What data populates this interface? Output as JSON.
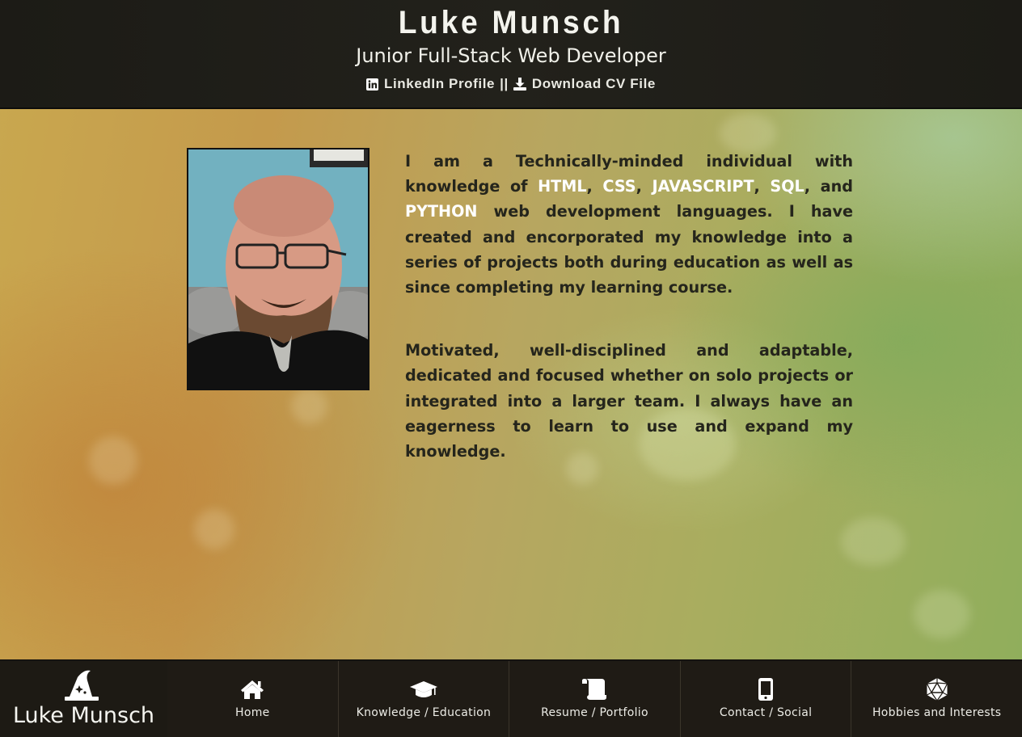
{
  "header": {
    "name": "Luke Munsch",
    "role": "Junior Full-Stack Web Developer",
    "linkedin_label": "LinkedIn Profile",
    "separator": "||",
    "cv_label": "Download CV File"
  },
  "about": {
    "p1_start": "I am a Technically-minded individual with knowledge of ",
    "skills": [
      "HTML",
      "CSS",
      "JAVASCRIPT",
      "SQL",
      "PYTHON"
    ],
    "sep_comma": ", ",
    "sep_and": ", and ",
    "p1_end": " web development languages. I have created and encorporated my knowledge into a series of projects both during education as well as since completing my learning course.",
    "p2": "Motivated, well-disciplined and adaptable, dedicated and focused whether on solo projects or integrated into a larger team. I always have an eagerness to learn to use and expand my knowledge."
  },
  "footer": {
    "brand": "Luke Munsch",
    "nav": [
      {
        "label": "Home",
        "icon": "home-icon"
      },
      {
        "label": "Knowledge / Education",
        "icon": "graduation-cap-icon"
      },
      {
        "label": "Resume / Portfolio",
        "icon": "scroll-icon"
      },
      {
        "label": "Contact / Social",
        "icon": "mobile-phone-icon"
      },
      {
        "label": "Hobbies and Interests",
        "icon": "d20-dice-icon"
      }
    ]
  },
  "colors": {
    "header_bg": "#1f1e18",
    "footer_bg": "#211d16",
    "skill_highlight": "#ffffff",
    "body_text": "#25251c"
  }
}
